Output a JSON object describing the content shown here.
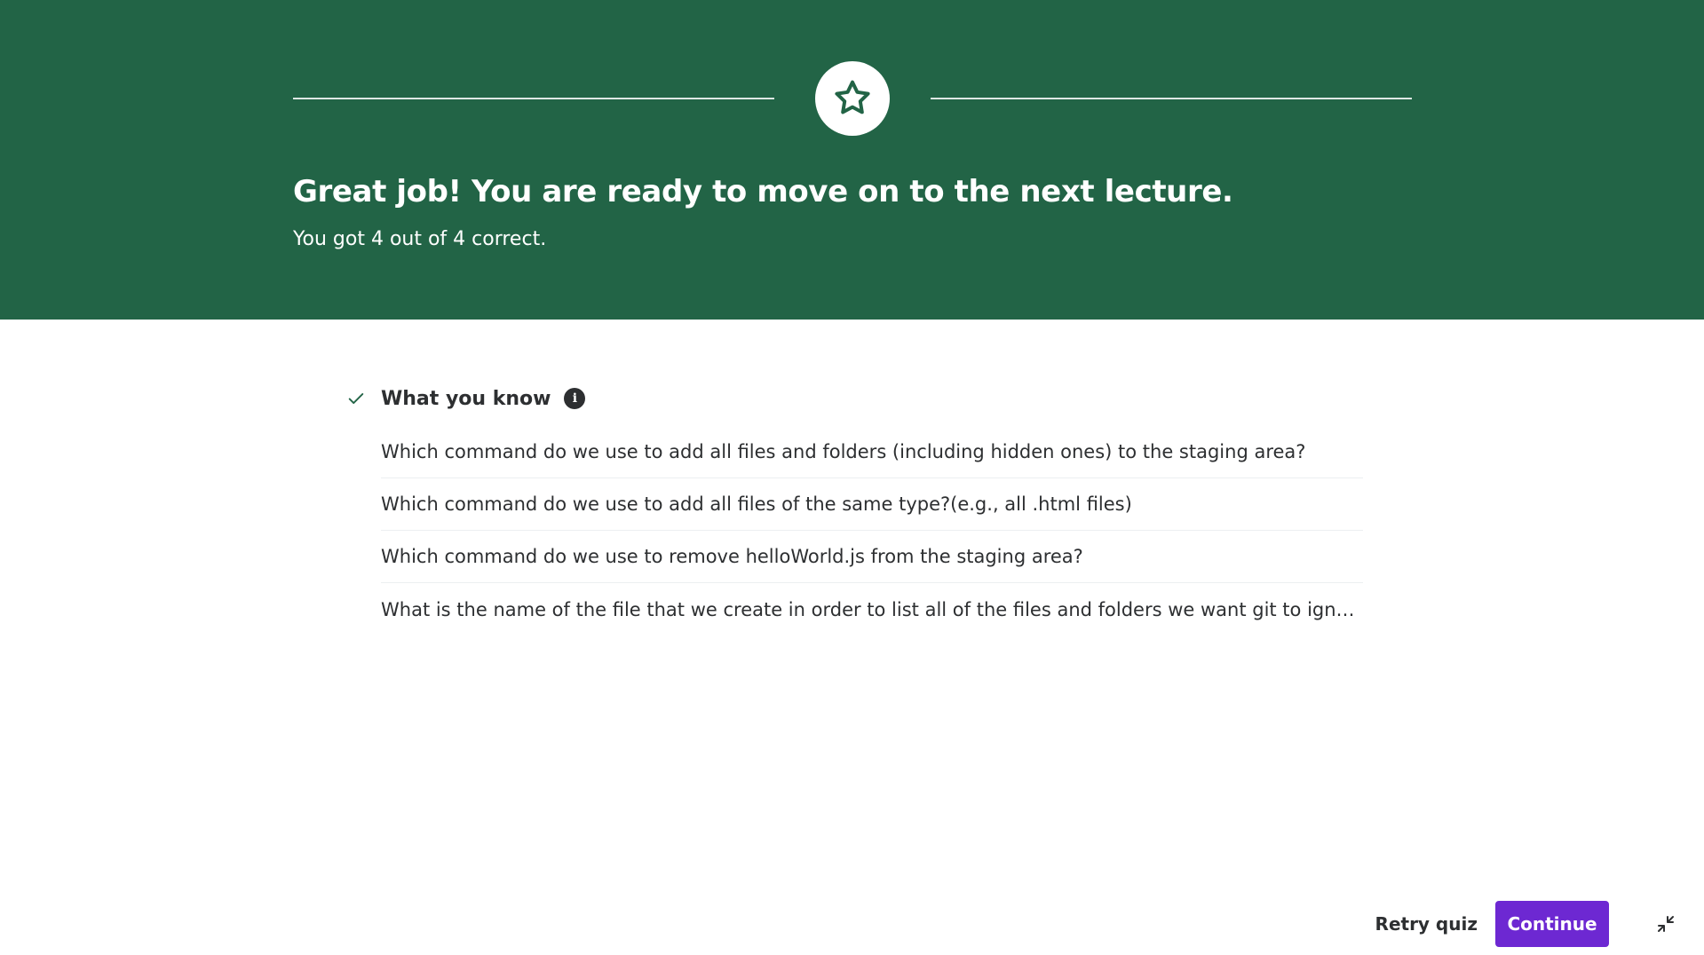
{
  "hero": {
    "title": "Great job! You are ready to move on to the next lecture.",
    "subtitle": "You got 4 out of 4 correct.",
    "background_color": "#226446",
    "badge_icon": "star-icon"
  },
  "what_you_know": {
    "title": "What you know",
    "status_icon": "check-icon",
    "info_icon": "info-icon",
    "info_glyph": "i",
    "questions": [
      "Which command do we use to add all files and folders (including hidden ones) to the staging area?",
      "Which command do we use to add all files of the same type?(e.g., all .html files)",
      "Which command do we use to remove helloWorld.js from the staging area?",
      "What is the name of the file that we create in order to list all of the files and folders we want git to ign…"
    ]
  },
  "footer": {
    "retry_label": "Retry quiz",
    "continue_label": "Continue",
    "continue_color": "#6d28d2",
    "collapse_icon": "collapse-icon"
  }
}
